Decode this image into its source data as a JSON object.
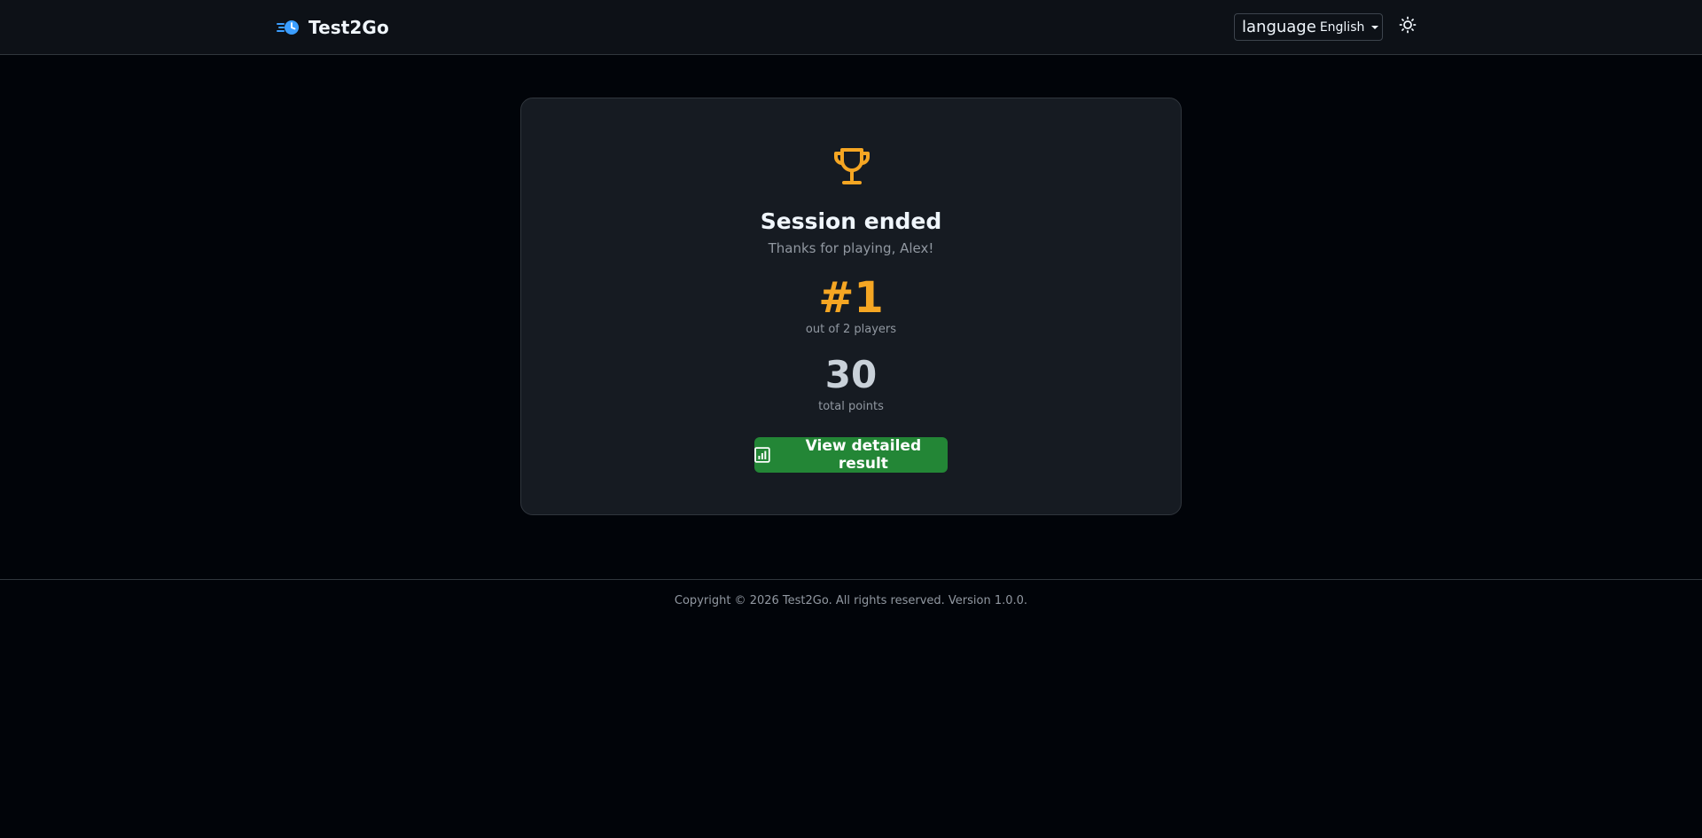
{
  "app": {
    "brand_name": "Test2Go",
    "brand_icon": "fast-clock-icon"
  },
  "header": {
    "language_label": "language",
    "language_value": "English",
    "theme_icon": "sun-icon"
  },
  "result_card": {
    "icon": "trophy-icon",
    "title": "Session ended",
    "subtitle": "Thanks for playing, Alex!",
    "rank": "#1",
    "rank_label": "out of 2 players",
    "points": "30",
    "points_label": "total points",
    "button_label": "View detailed result",
    "button_icon": "bar-chart-icon"
  },
  "footer": {
    "copyright": "Copyright © 2026 Test2Go. All rights reserved. Version 1.0.0."
  },
  "colors": {
    "background": "#010409",
    "surface": "#161b22",
    "accent_gold": "#f5a623",
    "button_green": "#238636",
    "brand_blue": "#3b9eff"
  }
}
